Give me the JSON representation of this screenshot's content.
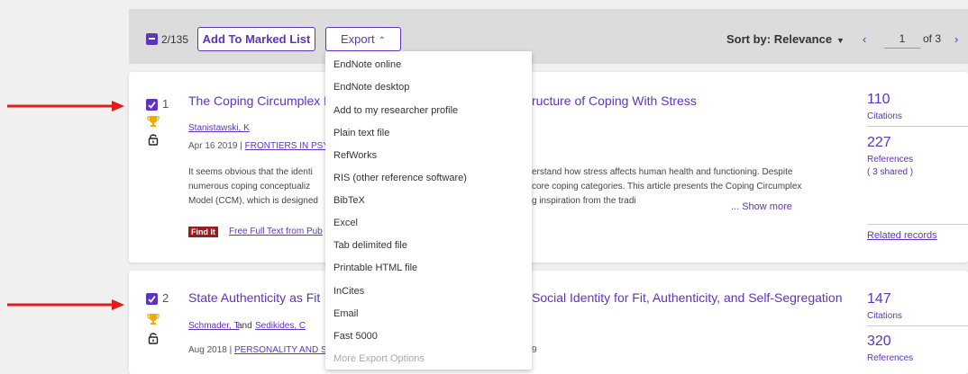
{
  "toolbar": {
    "selected_count": "2/135",
    "add_to_marked_list": "Add To Marked List",
    "export_label": "Export",
    "sort_by": "Sort by: Relevance",
    "pager_prev": "‹",
    "pager_page": "1",
    "pager_of": "of 3",
    "pager_next": "›"
  },
  "export_menu": {
    "items": [
      "EndNote online",
      "EndNote desktop",
      "Add to my researcher profile",
      "Plain text file",
      "RefWorks",
      "RIS (other reference software)",
      "BibTeX",
      "Excel",
      "Tab delimited file",
      "Printable HTML file",
      "InCites",
      "Email",
      "Fast 5000",
      "More Export Options"
    ]
  },
  "records": [
    {
      "number": "1",
      "title_left": "The Coping Circumplex M",
      "title_right": "ructure of Coping With Stress",
      "author": "Stanistawski, K",
      "date": "Apr 16 2019 | ",
      "journal": "FRONTIERS IN PSY",
      "abstract_line1_left": "It seems obvious that the identi",
      "abstract_line1_right": "erstand how stress affects human health and functioning. Despite",
      "abstract_line2_left": "numerous coping conceptualiz",
      "abstract_line2_right": "core coping categories. This article presents the Coping Circumplex",
      "abstract_line3_left": "Model (CCM), which is designed",
      "abstract_line3_right": "g inspiration from the tradi",
      "show_more": "...  Show more",
      "find_it": "Find It",
      "free_text": "Free Full Text from Pub",
      "citations": "110",
      "citations_label": "Citations",
      "references": "227",
      "references_label": "References",
      "shared": "( 3 shared )",
      "related": "Related records"
    },
    {
      "number": "2",
      "title_left": "State Authenticity as Fit",
      "title_right": "Social Identity for Fit, Authenticity, and Self-Segregation",
      "author1": "Schmader, T",
      "and": "and",
      "author2": "Sedikides, C",
      "date": "Aug 2018 | ",
      "journal": "PERSONALITY AND S",
      "meta_right": "9",
      "citations": "147",
      "citations_label": "Citations",
      "references": "320",
      "references_label": "References"
    }
  ],
  "colors": {
    "accent": "#5e33bf",
    "arrow": "#e31b1b",
    "trophy": "#f2a900",
    "find_it_bg": "#9b1b1b"
  }
}
